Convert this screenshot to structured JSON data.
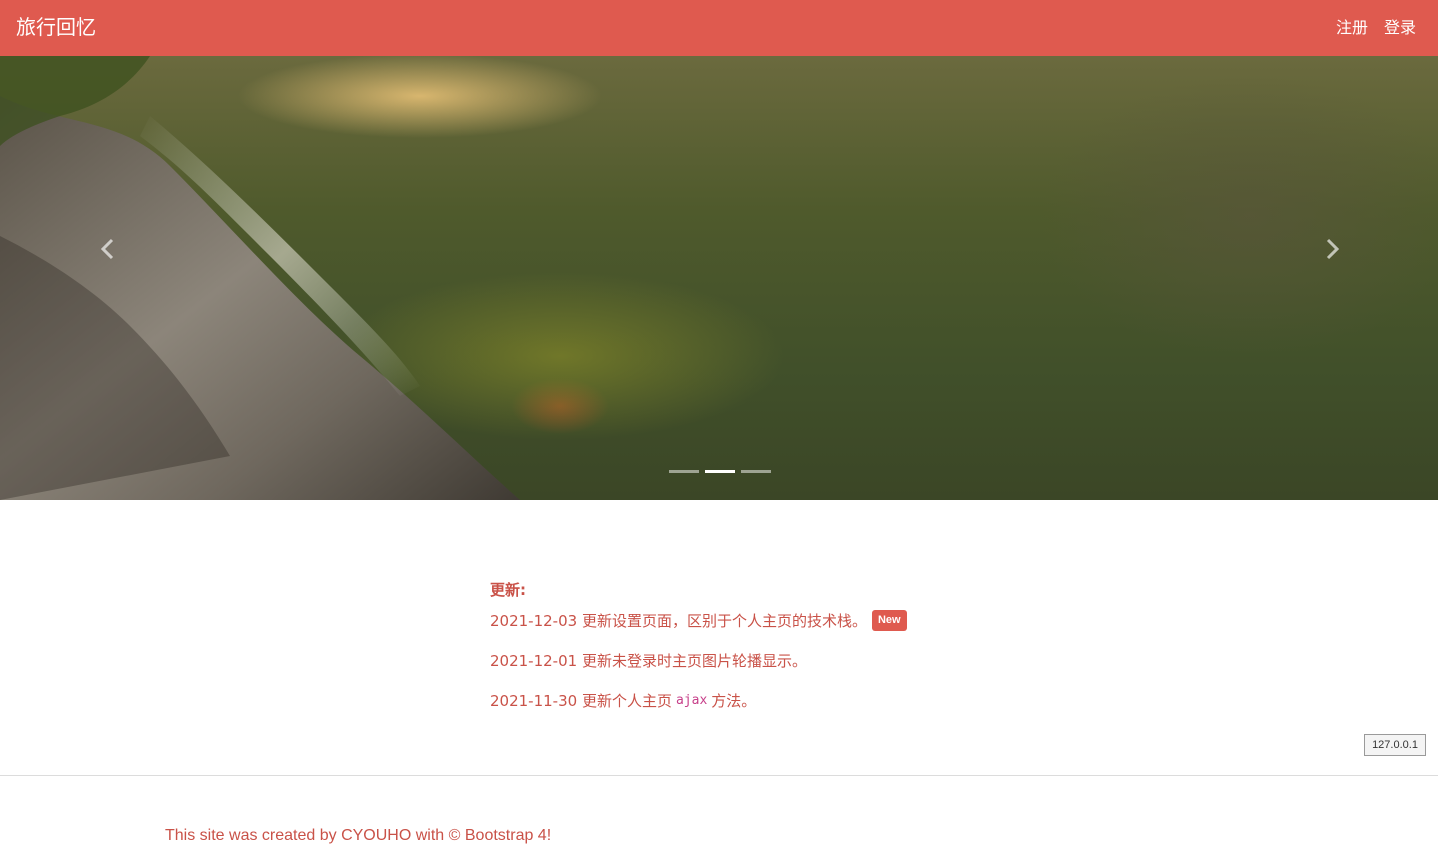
{
  "navbar": {
    "brand": "旅行回忆",
    "links": [
      "注册",
      "登录"
    ]
  },
  "carousel": {
    "slide_count": 3,
    "active_index": 1
  },
  "updates": {
    "title": "更新:",
    "items": [
      {
        "date": "2021-12-03",
        "text": "更新设置页面，区别于个人主页的技术栈。",
        "badge": "New"
      },
      {
        "date": "2021-12-01",
        "text": "更新未登录时主页图片轮播显示。"
      },
      {
        "date": "2021-11-30",
        "text_before": "更新个人主页",
        "code": "ajax",
        "text_after": "方法。"
      }
    ]
  },
  "ip_label": "127.0.0.1",
  "footer": {
    "text": "This site was created by CYOUHO with © Bootstrap 4!"
  },
  "colors": {
    "brand_red": "#df5a4f",
    "text_red": "#c95248",
    "code_pink": "#c7408a"
  }
}
